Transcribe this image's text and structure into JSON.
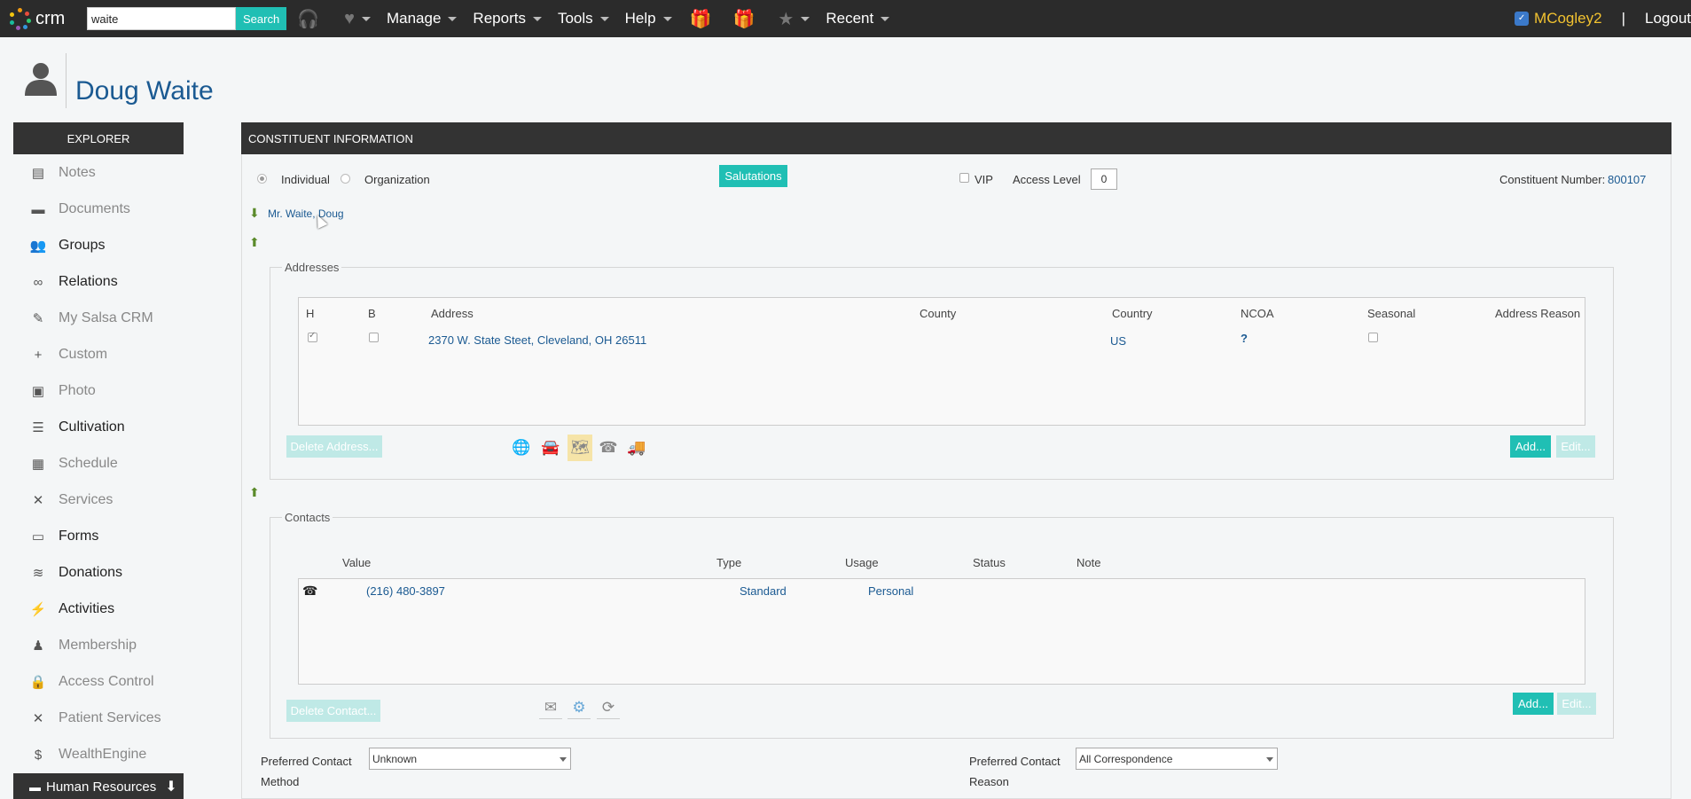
{
  "topbar": {
    "logo_text": "crm",
    "search_value": "waite",
    "search_label": "Search",
    "menus": [
      "Manage",
      "Reports",
      "Tools",
      "Help",
      "Recent"
    ],
    "username": "MCogley2",
    "separator": "|",
    "logout": "Logout"
  },
  "header": {
    "title": "Doug Waite"
  },
  "sidebar": {
    "title": "EXPLORER",
    "items": [
      {
        "label": "Notes",
        "icon": "notes-icon",
        "glyph": "▤",
        "dim": true
      },
      {
        "label": "Documents",
        "icon": "folder-icon",
        "glyph": "▬",
        "dim": true
      },
      {
        "label": "Groups",
        "icon": "groups-icon",
        "glyph": "👥",
        "dim": false
      },
      {
        "label": "Relations",
        "icon": "link-icon",
        "glyph": "∞",
        "dim": false
      },
      {
        "label": "My Salsa CRM",
        "icon": "user-edit-icon",
        "glyph": "✎",
        "dim": true
      },
      {
        "label": "Custom",
        "icon": "plus-icon",
        "glyph": "+",
        "dim": true
      },
      {
        "label": "Photo",
        "icon": "image-icon",
        "glyph": "▣",
        "dim": true
      },
      {
        "label": "Cultivation",
        "icon": "list-icon",
        "glyph": "☰",
        "dim": false
      },
      {
        "label": "Schedule",
        "icon": "calendar-icon",
        "glyph": "▦",
        "dim": true
      },
      {
        "label": "Services",
        "icon": "tools-icon",
        "glyph": "✕",
        "dim": true
      },
      {
        "label": "Forms",
        "icon": "forms-icon",
        "glyph": "▭",
        "dim": false
      },
      {
        "label": "Donations",
        "icon": "coins-icon",
        "glyph": "≋",
        "dim": false
      },
      {
        "label": "Activities",
        "icon": "bolt-icon",
        "glyph": "⚡",
        "dim": false
      },
      {
        "label": "Membership",
        "icon": "member-icon",
        "glyph": "♟",
        "dim": true
      },
      {
        "label": "Access Control",
        "icon": "lock-icon",
        "glyph": "🔒",
        "dim": true
      },
      {
        "label": "Patient Services",
        "icon": "tools-icon",
        "glyph": "✕",
        "dim": true
      },
      {
        "label": "WealthEngine",
        "icon": "dollar-icon",
        "glyph": "$",
        "dim": true
      }
    ],
    "bottom_tab": "Human Resources"
  },
  "panel": {
    "title": "CONSTITUENT INFORMATION",
    "type_individual": "Individual",
    "type_organization": "Organization",
    "salutations": "Salutations",
    "vip": "VIP",
    "access_level_label": "Access Level",
    "access_level_value": "0",
    "constituent_number_label": "Constituent Number:",
    "constituent_number": "800107",
    "display_name": "Mr. Waite, Doug"
  },
  "addresses": {
    "legend": "Addresses",
    "columns": [
      "H",
      "B",
      "Address",
      "County",
      "Country",
      "NCOA",
      "Seasonal",
      "Address Reason"
    ],
    "rows": [
      {
        "address": "2370 W. State Steet, Cleveland, OH 26511",
        "county": "",
        "country": "US",
        "ncoa": "?",
        "home": true,
        "business": false,
        "seasonal": false
      }
    ],
    "delete_label": "Delete Address...",
    "add_label": "Add...",
    "edit_label": "Edit..."
  },
  "contacts": {
    "legend": "Contacts",
    "columns": [
      "Value",
      "Type",
      "Usage",
      "Status",
      "Note"
    ],
    "rows": [
      {
        "value": "(216) 480-3897",
        "type": "Standard",
        "usage": "Personal",
        "status": "",
        "note": ""
      }
    ],
    "delete_label": "Delete Contact...",
    "add_label": "Add...",
    "edit_label": "Edit..."
  },
  "preferences": {
    "method_label_1": "Preferred Contact",
    "method_label_2": "Method",
    "method_value": "Unknown",
    "reason_label_1": "Preferred Contact",
    "reason_label_2": "Reason",
    "reason_value": "All Correspondence"
  }
}
